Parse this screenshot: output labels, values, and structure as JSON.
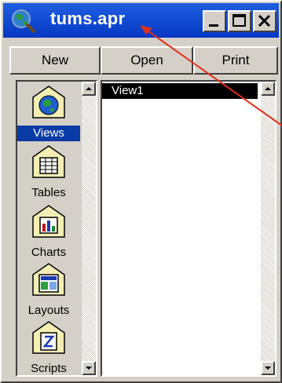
{
  "window": {
    "title": "tums.apr",
    "title_icon": "globe-magnifier-icon",
    "titlebar_color": "#0a46d8",
    "caption_buttons": [
      "minimize-icon",
      "maximize-icon",
      "close-icon"
    ]
  },
  "toolbar": {
    "new_label": "New",
    "open_label": "Open",
    "print_label": "Print"
  },
  "doc_types": [
    {
      "label": "Views",
      "icon": "globe-icon",
      "selected": true
    },
    {
      "label": "Tables",
      "icon": "table-icon",
      "selected": false
    },
    {
      "label": "Charts",
      "icon": "bar-chart-icon",
      "selected": false
    },
    {
      "label": "Layouts",
      "icon": "layout-icon",
      "selected": false
    },
    {
      "label": "Scripts",
      "icon": "script-icon",
      "selected": false
    }
  ],
  "document_list": {
    "items": [
      "View1"
    ],
    "selected": "View1"
  },
  "annotation": {
    "arrow_color": "#e0301a"
  }
}
